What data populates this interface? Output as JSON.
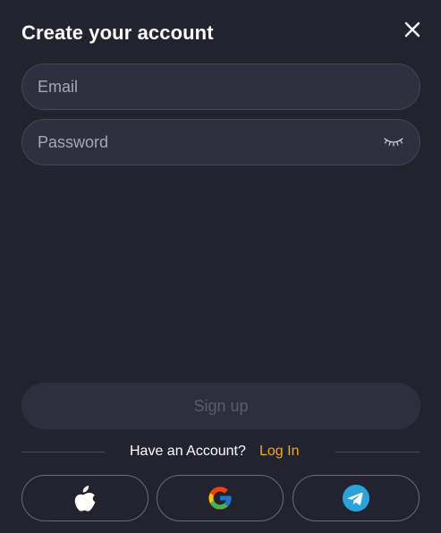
{
  "modal": {
    "title": "Create your account"
  },
  "form": {
    "email": {
      "placeholder": "Email",
      "value": ""
    },
    "password": {
      "placeholder": "Password",
      "value": ""
    },
    "signup_label": "Sign up"
  },
  "footer": {
    "have_account_text": "Have an Account?",
    "login_label": "Log In"
  },
  "social": [
    {
      "provider": "apple",
      "icon": "apple-icon"
    },
    {
      "provider": "google",
      "icon": "google-icon"
    },
    {
      "provider": "telegram",
      "icon": "telegram-icon"
    }
  ],
  "icons": {
    "close": "close-icon",
    "password_toggle": "eye-closed-icon"
  },
  "colors": {
    "background": "#232330",
    "field_background": "#2f2f3f",
    "field_border": "#44445a",
    "accent": "#f0a81c",
    "disabled_text": "#5c5c6e",
    "telegram": "#2aa3dd"
  }
}
